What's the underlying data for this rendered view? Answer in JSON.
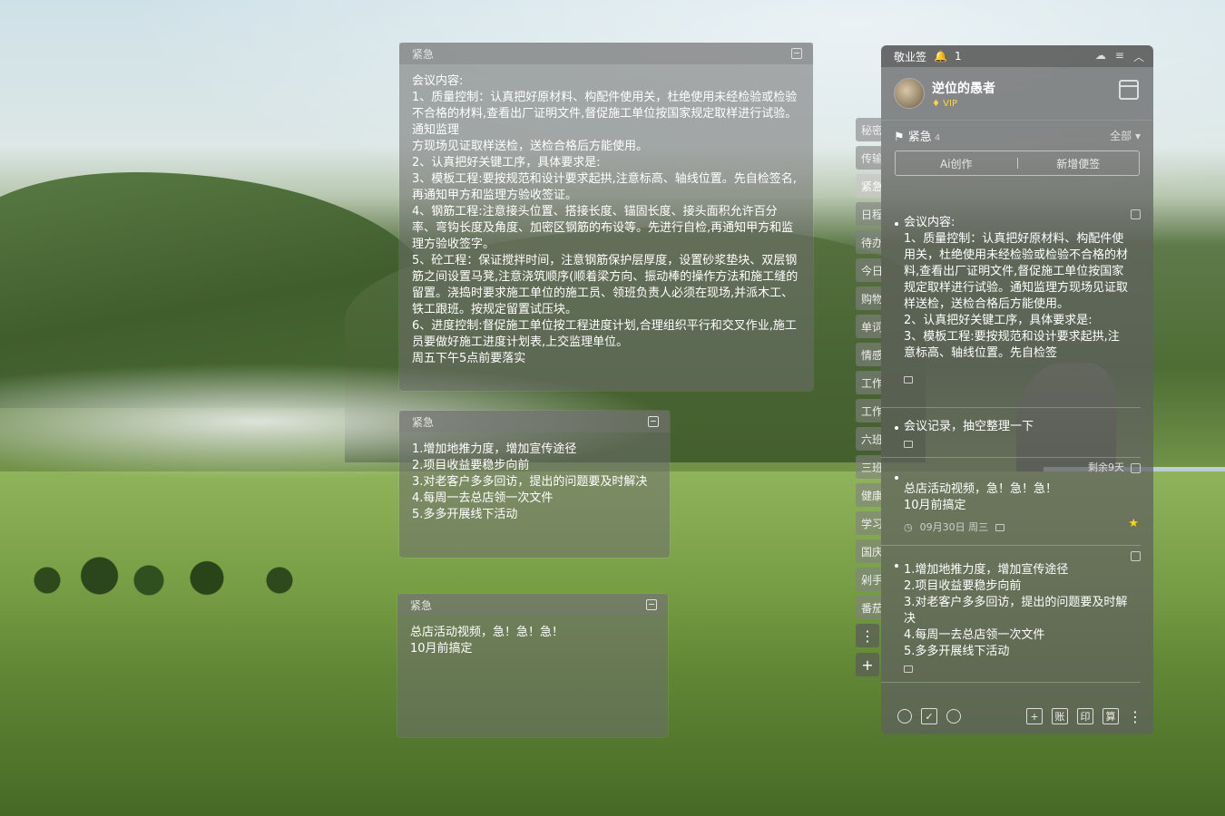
{
  "notes": [
    {
      "category": "紧急",
      "body": "会议内容:\n1、质量控制：认真把好原材料、构配件使用关，杜绝使用未经检验或检验不合格的材料,查看出厂证明文件,督促施工单位按国家规定取样进行试验。通知监理\n方现场见证取样送检，送检合格后方能使用。\n2、认真把好关键工序，具体要求是:\n3、模板工程:要按规范和设计要求起拱,注意标高、轴线位置。先自检签名,再通知甲方和监理方验收签证。\n4、钢筋工程:注意接头位置、搭接长度、锚固长度、接头面积允许百分率、弯钩长度及角度、加密区钢筋的布设等。先进行自检,再通知甲方和监理方验收签字。\n5、砼工程：保证搅拌时间，注意钢筋保护层厚度，设置砂浆垫块、双层钢筋之间设置马凳,注意浇筑顺序(顺着梁方向、振动棒的操作方法和施工缝的留置。浇捣时要求施工单位的施工员、领班负责人必须在现场,并派木工、铁工跟班。按规定留置试压块。\n6、进度控制:督促施工单位按工程进度计划,合理组织平行和交叉作业,施工员要做好施工进度计划表,上交监理单位。\n周五下午5点前要落实"
    },
    {
      "category": "紧急",
      "body": "1.增加地推力度，增加宣传途径\n2.项目收益要稳步向前\n3.对老客户多多回访，提出的问题要及时解决\n4.每周一去总店领一次文件\n5.多多开展线下活动"
    },
    {
      "category": "紧急",
      "body": "总店活动视频，急！急！急！\n10月前搞定"
    }
  ],
  "tabs": [
    "秘密",
    "传输",
    "紧急",
    "日程",
    "待办",
    "今日",
    "购物",
    "单词",
    "情感",
    "工作",
    "工作",
    "六班",
    "三班",
    "健康",
    "学习",
    "国庆",
    "剁手",
    "番茄"
  ],
  "tab_more": "⋮",
  "tab_add": "+",
  "panel": {
    "title": "敬业签",
    "notify_count": "1",
    "user_name": "逆位的愚者",
    "vip": "VIP",
    "category": "紧急",
    "category_count": "4",
    "filter": "全部",
    "ai_label": "Ai创作",
    "new_label": "新增便签",
    "items": [
      {
        "text": "会议内容:\n1、质量控制：认真把好原材料、构配件使用关，杜绝使用未经检验或检验不合格的材料,查看出厂证明文件,督促施工单位按国家规定取样进行试验。通知监理方现场见证取样送检，送检合格后方能使用。\n2、认真把好关键工序，具体要求是:\n3、模板工程:要按规范和设计要求起拱,注意标高、轴线位置。先自检签"
      },
      {
        "text": "会议记录，抽空整理一下"
      },
      {
        "text": "总店活动视频，急！急！急！\n10月前搞定",
        "remain": "剩余9天",
        "date": "09月30日 周三"
      },
      {
        "text": "1.增加地推力度，增加宣传途径\n2.项目收益要稳步向前\n3.对老客户多多回访，提出的问题要及时解决\n4.每周一去总店领一次文件\n5.多多开展线下活动"
      }
    ],
    "bottom_right": [
      "+",
      "账",
      "印",
      "算"
    ]
  }
}
